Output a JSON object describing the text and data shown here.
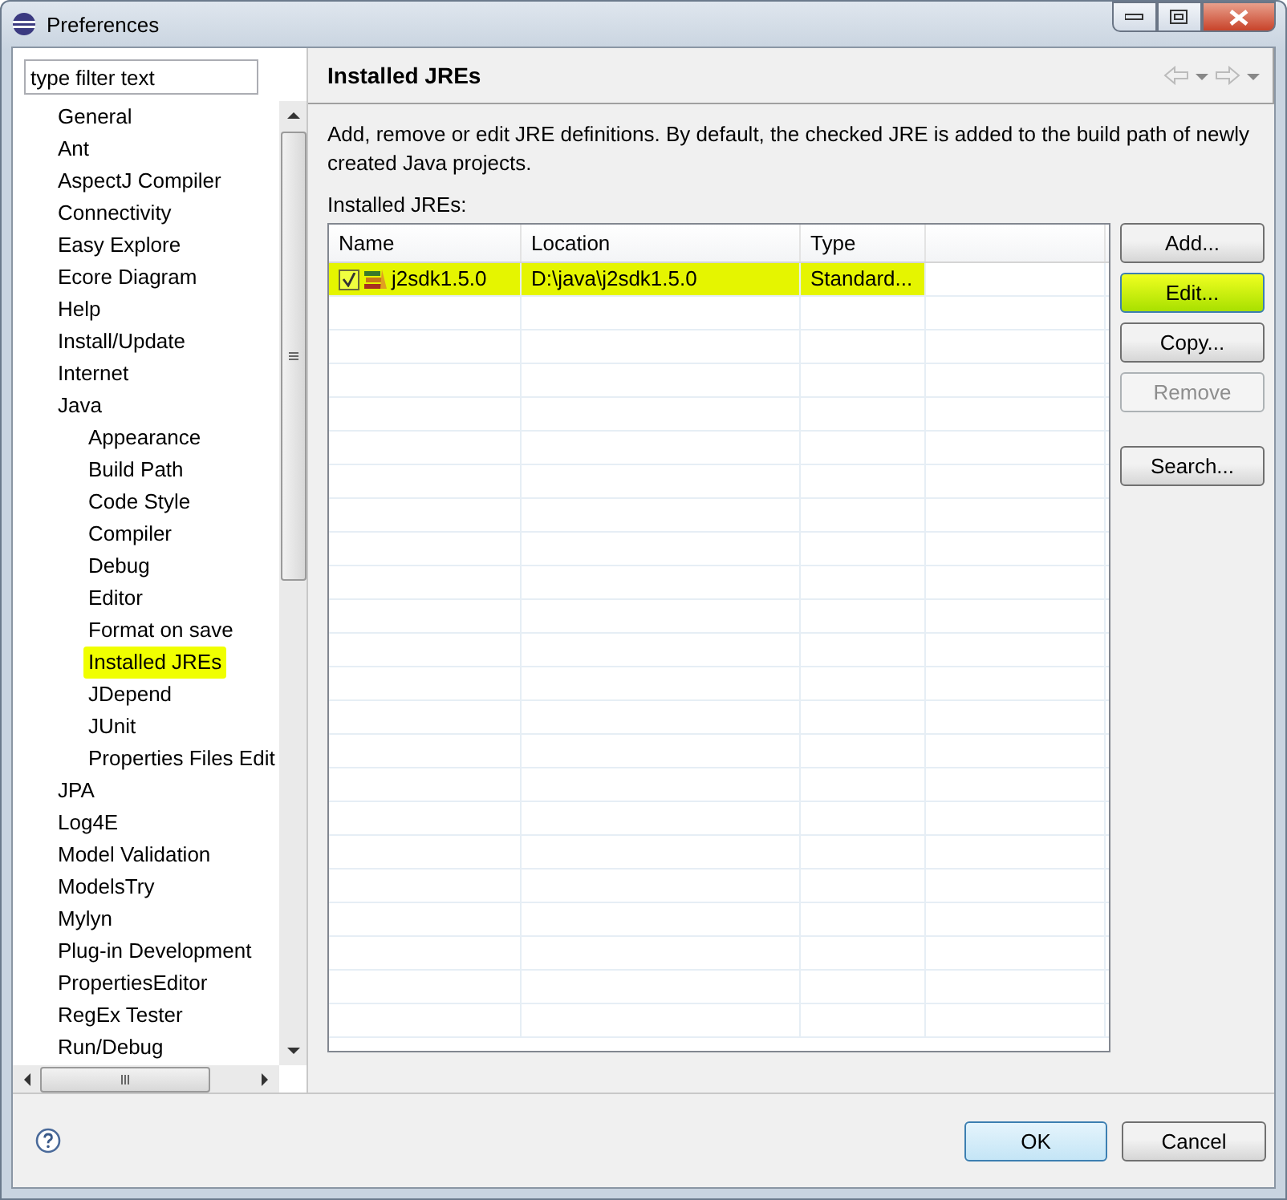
{
  "window": {
    "title": "Preferences"
  },
  "filter": {
    "placeholder": "type filter text"
  },
  "tree": [
    {
      "label": "General",
      "selected": false
    },
    {
      "label": "Ant",
      "selected": false
    },
    {
      "label": "AspectJ Compiler",
      "selected": false
    },
    {
      "label": "Connectivity",
      "selected": false
    },
    {
      "label": "Easy Explore",
      "selected": false
    },
    {
      "label": "Ecore Diagram",
      "selected": false
    },
    {
      "label": "Help",
      "selected": false
    },
    {
      "label": "Install/Update",
      "selected": false
    },
    {
      "label": "Internet",
      "selected": false
    },
    {
      "label": "Java",
      "selected": false,
      "children": [
        {
          "label": "Appearance",
          "selected": false
        },
        {
          "label": "Build Path",
          "selected": false
        },
        {
          "label": "Code Style",
          "selected": false
        },
        {
          "label": "Compiler",
          "selected": false
        },
        {
          "label": "Debug",
          "selected": false
        },
        {
          "label": "Editor",
          "selected": false
        },
        {
          "label": "Format on save",
          "selected": false
        },
        {
          "label": "Installed JREs",
          "selected": true
        },
        {
          "label": "JDepend",
          "selected": false
        },
        {
          "label": "JUnit",
          "selected": false
        },
        {
          "label": "Properties Files Edit",
          "selected": false
        }
      ]
    },
    {
      "label": "JPA",
      "selected": false
    },
    {
      "label": "Log4E",
      "selected": false
    },
    {
      "label": "Model Validation",
      "selected": false
    },
    {
      "label": "ModelsTry",
      "selected": false
    },
    {
      "label": "Mylyn",
      "selected": false
    },
    {
      "label": "Plug-in Development",
      "selected": false
    },
    {
      "label": "PropertiesEditor",
      "selected": false
    },
    {
      "label": "RegEx Tester",
      "selected": false
    },
    {
      "label": "Run/Debug",
      "selected": false
    }
  ],
  "page": {
    "title": "Installed JREs",
    "description": "Add, remove or edit JRE definitions. By default, the checked JRE is added to the build path of newly created Java projects.",
    "list_label": "Installed JREs:"
  },
  "table": {
    "columns": [
      "Name",
      "Location",
      "Type"
    ],
    "rows": [
      {
        "name": "j2sdk1.5.0",
        "location": "D:\\java\\j2sdk1.5.0",
        "type": "Standard...",
        "checked": true,
        "selected": true
      }
    ]
  },
  "side_buttons": [
    {
      "label": "Add...",
      "disabled": false,
      "highlighted": false
    },
    {
      "label": "Edit...",
      "disabled": false,
      "highlighted": true
    },
    {
      "label": "Copy...",
      "disabled": false,
      "highlighted": false
    },
    {
      "label": "Remove",
      "disabled": true,
      "highlighted": false
    },
    {
      "label": "Search...",
      "disabled": false,
      "highlighted": false
    }
  ],
  "footer_buttons": [
    {
      "label": "OK",
      "default": true
    },
    {
      "label": "Cancel",
      "default": false
    }
  ]
}
